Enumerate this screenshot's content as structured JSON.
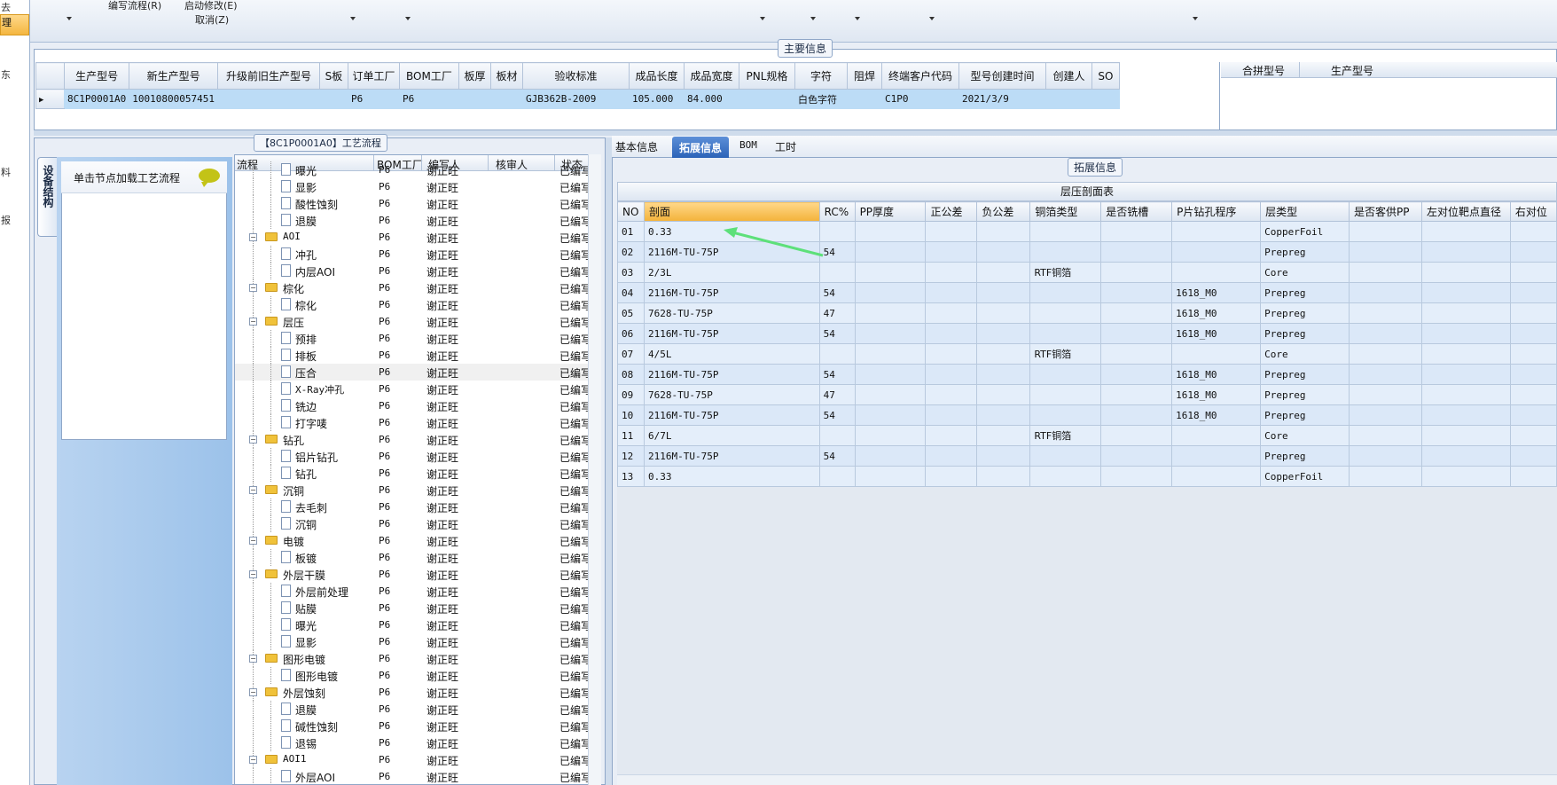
{
  "leftnav": {
    "items": [
      "去",
      "理",
      "东",
      "料",
      "报"
    ]
  },
  "toolbar": {
    "items": [
      "编写流程(R)",
      "启动修改(E)",
      "取消(Z)"
    ]
  },
  "main_group": {
    "title": "主要信息",
    "columns": [
      "生产型号",
      "新生产型号",
      "升级前旧生产型号",
      "S板",
      "订单工厂",
      "BOM工厂",
      "板厚",
      "板材",
      "验收标准",
      "成品长度",
      "成品宽度",
      "PNL规格",
      "字符",
      "阻焊",
      "终端客户代码",
      "型号创建时间",
      "创建人",
      "SO"
    ],
    "row": [
      "8C1P0001A0",
      "10010800057451",
      "",
      "",
      "P6",
      "P6",
      "",
      "",
      "GJB362B-2009",
      "105.000",
      "84.000",
      "",
      "白色字符",
      "",
      "C1P0",
      "2021/3/9",
      "",
      ""
    ],
    "merge_columns": [
      "合拼型号",
      "生产型号"
    ]
  },
  "process": {
    "title": "【8C1P0001A0】工艺流程",
    "vertical_tab": "设备结构",
    "hint": "单击节点加载工艺流程",
    "columns": [
      "流程",
      "BOM工厂",
      "编写人",
      "核审人",
      "状态"
    ],
    "rows": [
      {
        "name": "曝光",
        "level": 2,
        "factory": "P6",
        "writer": "谢正旺",
        "status": "已编写"
      },
      {
        "name": "显影",
        "level": 2,
        "factory": "P6",
        "writer": "谢正旺",
        "status": "已编写"
      },
      {
        "name": "酸性蚀刻",
        "level": 2,
        "factory": "P6",
        "writer": "谢正旺",
        "status": "已编写"
      },
      {
        "name": "退膜",
        "level": 2,
        "factory": "P6",
        "writer": "谢正旺",
        "status": "已编写"
      },
      {
        "name": "AOI",
        "level": 1,
        "factory": "P6",
        "writer": "谢正旺",
        "status": "已编写"
      },
      {
        "name": "冲孔",
        "level": 2,
        "factory": "P6",
        "writer": "谢正旺",
        "status": "已编写"
      },
      {
        "name": "内层AOI",
        "level": 2,
        "factory": "P6",
        "writer": "谢正旺",
        "status": "已编写"
      },
      {
        "name": "棕化",
        "level": 1,
        "factory": "P6",
        "writer": "谢正旺",
        "status": "已编写"
      },
      {
        "name": "棕化",
        "level": 2,
        "factory": "P6",
        "writer": "谢正旺",
        "status": "已编写"
      },
      {
        "name": "层压",
        "level": 1,
        "factory": "P6",
        "writer": "谢正旺",
        "status": "已编写"
      },
      {
        "name": "预排",
        "level": 2,
        "factory": "P6",
        "writer": "谢正旺",
        "status": "已编写"
      },
      {
        "name": "排板",
        "level": 2,
        "factory": "P6",
        "writer": "谢正旺",
        "status": "已编写"
      },
      {
        "name": "压合",
        "level": 2,
        "factory": "P6",
        "writer": "谢正旺",
        "status": "已编写",
        "selected": true
      },
      {
        "name": "X-Ray冲孔",
        "level": 2,
        "factory": "P6",
        "writer": "谢正旺",
        "status": "已编写"
      },
      {
        "name": "铣边",
        "level": 2,
        "factory": "P6",
        "writer": "谢正旺",
        "status": "已编写"
      },
      {
        "name": "打字唛",
        "level": 2,
        "factory": "P6",
        "writer": "谢正旺",
        "status": "已编写"
      },
      {
        "name": "钻孔",
        "level": 1,
        "factory": "P6",
        "writer": "谢正旺",
        "status": "已编写"
      },
      {
        "name": "铝片钻孔",
        "level": 2,
        "factory": "P6",
        "writer": "谢正旺",
        "status": "已编写"
      },
      {
        "name": "钻孔",
        "level": 2,
        "factory": "P6",
        "writer": "谢正旺",
        "status": "已编写"
      },
      {
        "name": "沉铜",
        "level": 1,
        "factory": "P6",
        "writer": "谢正旺",
        "status": "已编写"
      },
      {
        "name": "去毛刺",
        "level": 2,
        "factory": "P6",
        "writer": "谢正旺",
        "status": "已编写"
      },
      {
        "name": "沉铜",
        "level": 2,
        "factory": "P6",
        "writer": "谢正旺",
        "status": "已编写"
      },
      {
        "name": "电镀",
        "level": 1,
        "factory": "P6",
        "writer": "谢正旺",
        "status": "已编写"
      },
      {
        "name": "板镀",
        "level": 2,
        "factory": "P6",
        "writer": "谢正旺",
        "status": "已编写"
      },
      {
        "name": "外层干膜",
        "level": 1,
        "factory": "P6",
        "writer": "谢正旺",
        "status": "已编写"
      },
      {
        "name": "外层前处理",
        "level": 2,
        "factory": "P6",
        "writer": "谢正旺",
        "status": "已编写"
      },
      {
        "name": "贴膜",
        "level": 2,
        "factory": "P6",
        "writer": "谢正旺",
        "status": "已编写"
      },
      {
        "name": "曝光",
        "level": 2,
        "factory": "P6",
        "writer": "谢正旺",
        "status": "已编写"
      },
      {
        "name": "显影",
        "level": 2,
        "factory": "P6",
        "writer": "谢正旺",
        "status": "已编写"
      },
      {
        "name": "图形电镀",
        "level": 1,
        "factory": "P6",
        "writer": "谢正旺",
        "status": "已编写"
      },
      {
        "name": "图形电镀",
        "level": 2,
        "factory": "P6",
        "writer": "谢正旺",
        "status": "已编写"
      },
      {
        "name": "外层蚀刻",
        "level": 1,
        "factory": "P6",
        "writer": "谢正旺",
        "status": "已编写"
      },
      {
        "name": "退膜",
        "level": 2,
        "factory": "P6",
        "writer": "谢正旺",
        "status": "已编写"
      },
      {
        "name": "碱性蚀刻",
        "level": 2,
        "factory": "P6",
        "writer": "谢正旺",
        "status": "已编写"
      },
      {
        "name": "退锡",
        "level": 2,
        "factory": "P6",
        "writer": "谢正旺",
        "status": "已编写"
      },
      {
        "name": "AOI1",
        "level": 1,
        "factory": "P6",
        "writer": "谢正旺",
        "status": "已编写"
      },
      {
        "name": "外层AOI",
        "level": 2,
        "factory": "P6",
        "writer": "谢正旺",
        "status": "已编写"
      }
    ]
  },
  "tabs": {
    "items": [
      "基本信息",
      "拓展信息",
      "BOM",
      "工时"
    ],
    "active": 1
  },
  "ext_group": {
    "title": "拓展信息"
  },
  "lamination": {
    "title": "层压剖面表",
    "columns": [
      "NO",
      "剖面",
      "RC%",
      "PP厚度",
      "正公差",
      "负公差",
      "铜箔类型",
      "是否铣槽",
      "P片钻孔程序",
      "层类型",
      "是否客供PP",
      "左对位靶点直径",
      "右对位"
    ],
    "rows": [
      [
        "01",
        "0.33",
        "",
        "",
        "",
        "",
        "",
        "",
        "",
        "CopperFoil",
        "",
        "",
        ""
      ],
      [
        "02",
        "2116M-TU-75P",
        "54",
        "",
        "",
        "",
        "",
        "",
        "",
        "Prepreg",
        "",
        "",
        ""
      ],
      [
        "03",
        "2/3L",
        "",
        "",
        "",
        "",
        "RTF铜箔",
        "",
        "",
        "Core",
        "",
        "",
        ""
      ],
      [
        "04",
        "2116M-TU-75P",
        "54",
        "",
        "",
        "",
        "",
        "",
        "1618_M0",
        "Prepreg",
        "",
        "",
        ""
      ],
      [
        "05",
        "7628-TU-75P",
        "47",
        "",
        "",
        "",
        "",
        "",
        "1618_M0",
        "Prepreg",
        "",
        "",
        ""
      ],
      [
        "06",
        "2116M-TU-75P",
        "54",
        "",
        "",
        "",
        "",
        "",
        "1618_M0",
        "Prepreg",
        "",
        "",
        ""
      ],
      [
        "07",
        "4/5L",
        "",
        "",
        "",
        "",
        "RTF铜箔",
        "",
        "",
        "Core",
        "",
        "",
        ""
      ],
      [
        "08",
        "2116M-TU-75P",
        "54",
        "",
        "",
        "",
        "",
        "",
        "1618_M0",
        "Prepreg",
        "",
        "",
        ""
      ],
      [
        "09",
        "7628-TU-75P",
        "47",
        "",
        "",
        "",
        "",
        "",
        "1618_M0",
        "Prepreg",
        "",
        "",
        ""
      ],
      [
        "10",
        "2116M-TU-75P",
        "54",
        "",
        "",
        "",
        "",
        "",
        "1618_M0",
        "Prepreg",
        "",
        "",
        ""
      ],
      [
        "11",
        "6/7L",
        "",
        "",
        "",
        "",
        "RTF铜箔",
        "",
        "",
        "Core",
        "",
        "",
        ""
      ],
      [
        "12",
        "2116M-TU-75P",
        "54",
        "",
        "",
        "",
        "",
        "",
        "",
        "Prepreg",
        "",
        "",
        ""
      ],
      [
        "13",
        "0.33",
        "",
        "",
        "",
        "",
        "",
        "",
        "",
        "CopperFoil",
        "",
        "",
        ""
      ]
    ],
    "highlight_column": 1,
    "highlight_row": 12
  },
  "colors": {
    "selection_blue": "#bcdcf6",
    "highlight_orange": "#f3b23a",
    "arrow_green": "#5de07a",
    "active_tab": "#2c63b8"
  }
}
